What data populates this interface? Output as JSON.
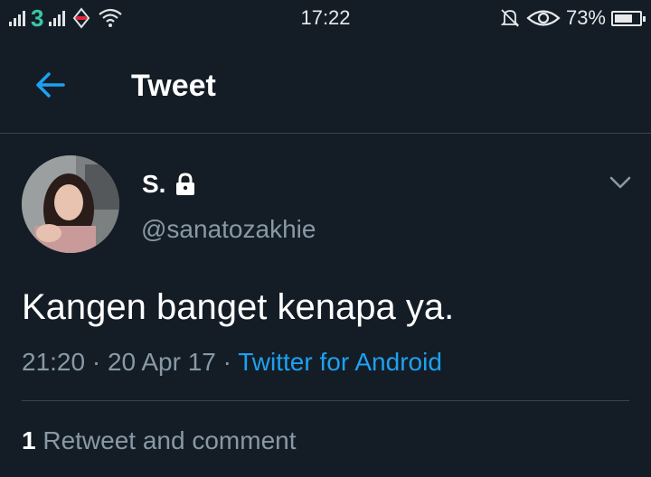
{
  "status_bar": {
    "carrier": "3",
    "time": "17:22",
    "battery": "73%",
    "battery_level": 0.73,
    "icons": [
      "signal-icon",
      "wifi-icon",
      "mute-icon",
      "eye-icon",
      "battery-icon"
    ]
  },
  "header": {
    "title": "Tweet",
    "back_icon": "arrow-left-icon"
  },
  "tweet": {
    "display_name": "S.",
    "protected_icon": "lock-icon",
    "handle": "@sanatozakhie",
    "text": "Kangen banget kenapa ya.",
    "time": "21:20",
    "separator": "·",
    "date": "20 Apr 17",
    "source": "Twitter for Android",
    "menu_icon": "chevron-down-icon"
  },
  "stats": {
    "count": "1",
    "label": "Retweet and comment"
  },
  "colors": {
    "background": "#141d26",
    "accent": "#1da1f2",
    "secondary_text": "#8899a6",
    "divider": "#38444d"
  }
}
